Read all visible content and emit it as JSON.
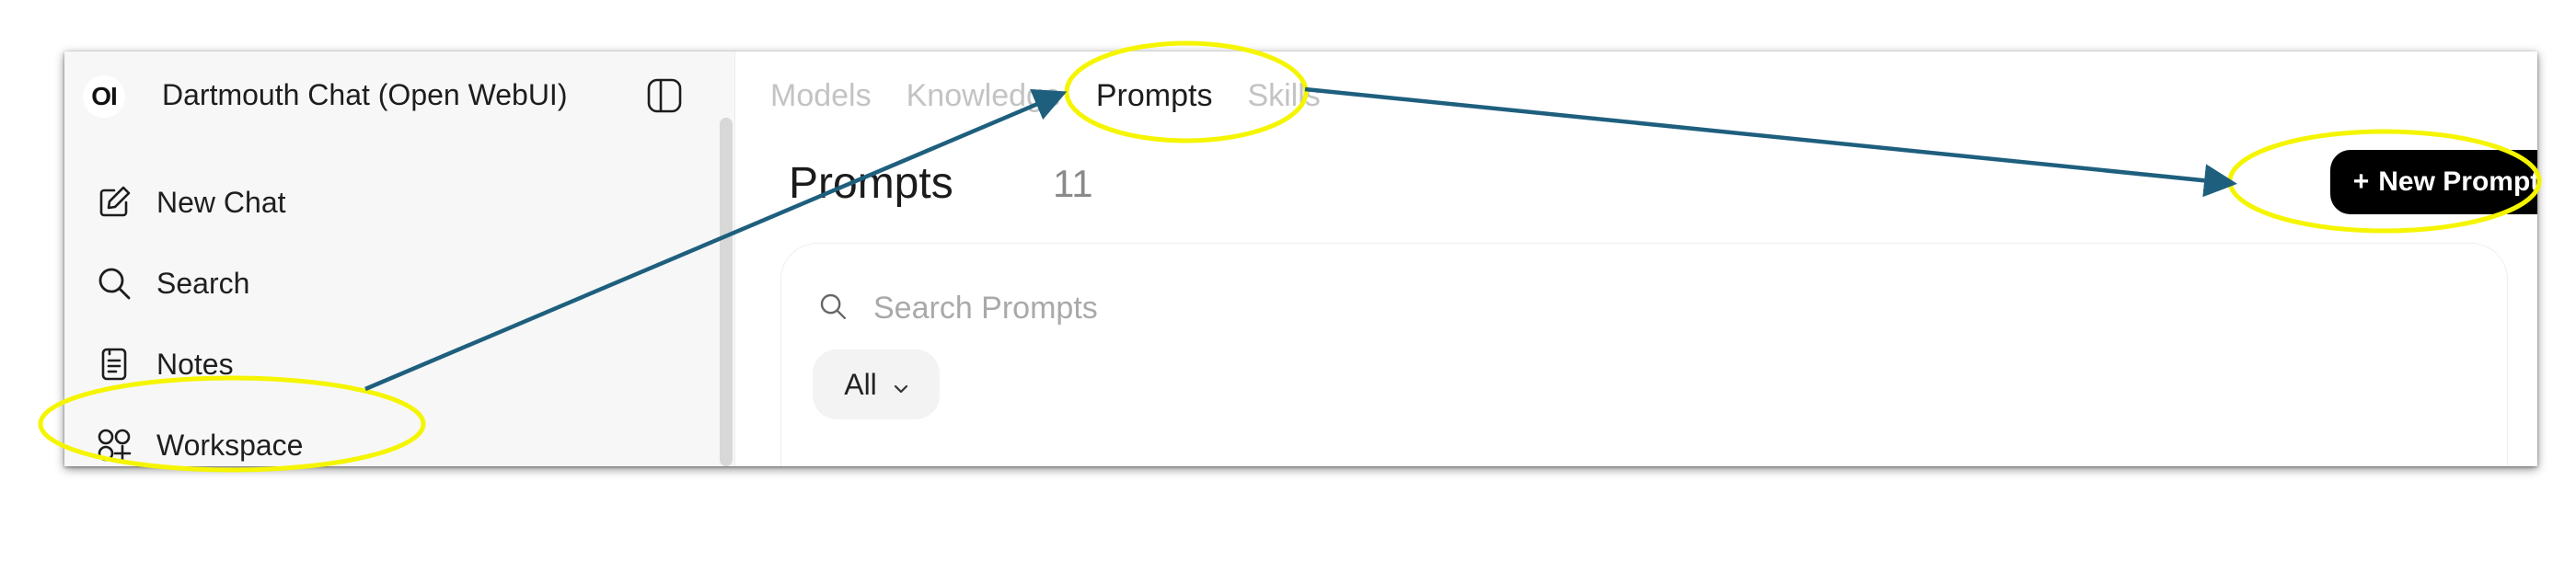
{
  "sidebar": {
    "logo_text": "OI",
    "app_title": "Dartmouth Chat (Open WebUI)",
    "toggle_icon": "sidebar-toggle-icon",
    "items": [
      {
        "label": "New Chat",
        "icon": "edit-icon"
      },
      {
        "label": "Search",
        "icon": "search-icon"
      },
      {
        "label": "Notes",
        "icon": "notes-icon"
      },
      {
        "label": "Workspace",
        "icon": "workspace-icon"
      }
    ]
  },
  "main": {
    "tabs": [
      {
        "label": "Models",
        "active": false
      },
      {
        "label": "Knowledge",
        "active": false
      },
      {
        "label": "Prompts",
        "active": true
      },
      {
        "label": "Skills",
        "active": false
      }
    ],
    "title": "Prompts",
    "count": "11",
    "new_button": {
      "plus": "+",
      "label": "New Prompt"
    },
    "search": {
      "placeholder": "Search Prompts",
      "value": ""
    },
    "filter": {
      "label": "All"
    }
  },
  "annotations": {
    "highlight_color": "#f5f500",
    "arrow_color": "#1e5f7e"
  }
}
